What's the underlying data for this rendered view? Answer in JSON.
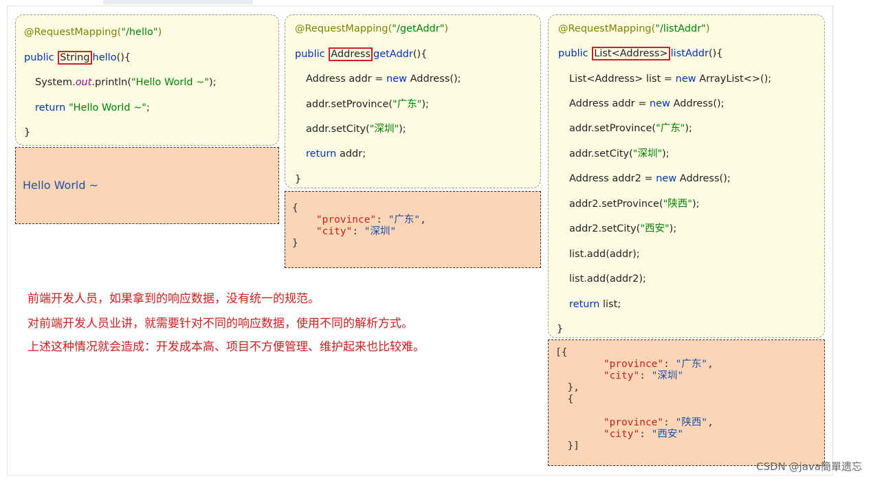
{
  "panel1": {
    "annotation": "@RequestMapping(",
    "path": "\"/hello\"",
    "close_paren": ")",
    "public": "public ",
    "ret_type": "String",
    "method": "hello",
    "sig_tail": "(){",
    "sys": "System.",
    "out": "out",
    "println": ".println(",
    "println_str": "\"Hello World ~\"",
    "println_end": ");",
    "return_kw": "return ",
    "return_str": "\"Hello World ~\"",
    "semi": ";",
    "close_brace": "}"
  },
  "resp1": {
    "text": "Hello World ~"
  },
  "panel2": {
    "annotation": "@RequestMapping(",
    "path": "\"/getAddr\"",
    "close_paren": ")",
    "public": "public ",
    "ret_type": "Address",
    "method": "getAddr",
    "sig_tail": "(){",
    "l1_a": "Address addr = ",
    "l1_new": "new",
    "l1_b": " Address();",
    "l2_a": "addr.setProvince(",
    "l2_s": "\"广东\"",
    "l2_b": ");",
    "l3_a": "addr.setCity(",
    "l3_s": "\"深圳\"",
    "l3_b": ");",
    "ret_kw": "return",
    "ret_b": " addr;",
    "close_brace": "}"
  },
  "resp2": {
    "open": "{",
    "k1": "\"province\"",
    "v1": "\"广东\"",
    "k2": "\"city\"",
    "v2": "\"深圳\"",
    "close": "}"
  },
  "panel3": {
    "annotation": "@RequestMapping(",
    "path": "\"/listAddr\"",
    "close_paren": ")",
    "public": "public ",
    "ret_type": "List<Address>",
    "method": "listAddr",
    "sig_tail": "(){",
    "l1_a": "List<Address> list = ",
    "l1_new": "new",
    "l1_b": " ArrayList<>();",
    "l2_a": "Address addr = ",
    "l2_new": "new",
    "l2_b": " Address();",
    "l3_a": "addr.setProvince(",
    "l3_s": "\"广东\"",
    "l3_b": ");",
    "l4_a": "addr.setCity(",
    "l4_s": "\"深圳\"",
    "l4_b": ");",
    "l5_a": "Address addr2 = ",
    "l5_new": "new",
    "l5_b": " Address();",
    "l6_a": "addr2.setProvince(",
    "l6_s": "\"陕西\"",
    "l6_b": ");",
    "l7_a": "addr2.setCity(",
    "l7_s": "\"西安\"",
    "l7_b": ");",
    "l8": "list.add(addr);",
    "l9": "list.add(addr2);",
    "ret_kw": "return",
    "ret_b": " list;",
    "close_brace": "}"
  },
  "resp3": {
    "open": "[{",
    "k1": "\"province\"",
    "v1": "\"广东\"",
    "k2": "\"city\"",
    "v2": "\"深圳\"",
    "mid1": "},",
    "mid2": "{",
    "k3": "\"province\"",
    "v3": "\"陕西\"",
    "k4": "\"city\"",
    "v4": "\"西安\"",
    "close": "}]"
  },
  "notes": [
    "前端开发人员，如果拿到的响应数据，没有统一的规范。",
    "对前端开发人员业讲，就需要针对不同的响应数据，使用不同的解析方式。",
    "上述这种情况就会造成：开发成本高、项目不方便管理、维护起来也比较难。"
  ],
  "watermark": "CSDN @java簡單遗忘"
}
